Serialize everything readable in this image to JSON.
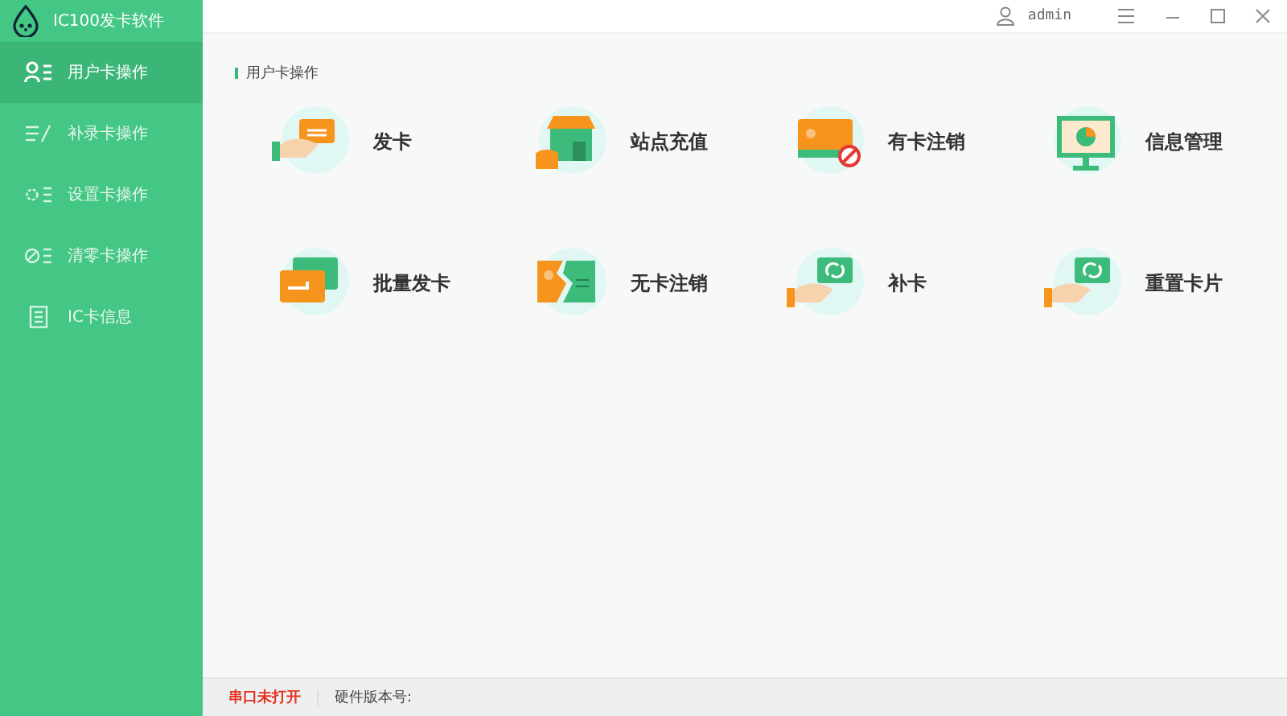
{
  "app": {
    "title": "IC100发卡软件"
  },
  "header": {
    "user": "admin"
  },
  "sidebar": {
    "items": [
      {
        "label": "用户卡操作",
        "selected": true
      },
      {
        "label": "补录卡操作",
        "selected": false
      },
      {
        "label": "设置卡操作",
        "selected": false
      },
      {
        "label": "清零卡操作",
        "selected": false
      },
      {
        "label": "IC卡信息",
        "selected": false
      }
    ]
  },
  "section": {
    "title": "用户卡操作"
  },
  "actions": [
    {
      "label": "发卡"
    },
    {
      "label": "站点充值"
    },
    {
      "label": "有卡注销"
    },
    {
      "label": "信息管理"
    },
    {
      "label": "批量发卡"
    },
    {
      "label": "无卡注销"
    },
    {
      "label": "补卡"
    },
    {
      "label": "重置卡片"
    }
  ],
  "status_bar": {
    "port": "串口未打开",
    "firmware": "硬件版本号:"
  }
}
